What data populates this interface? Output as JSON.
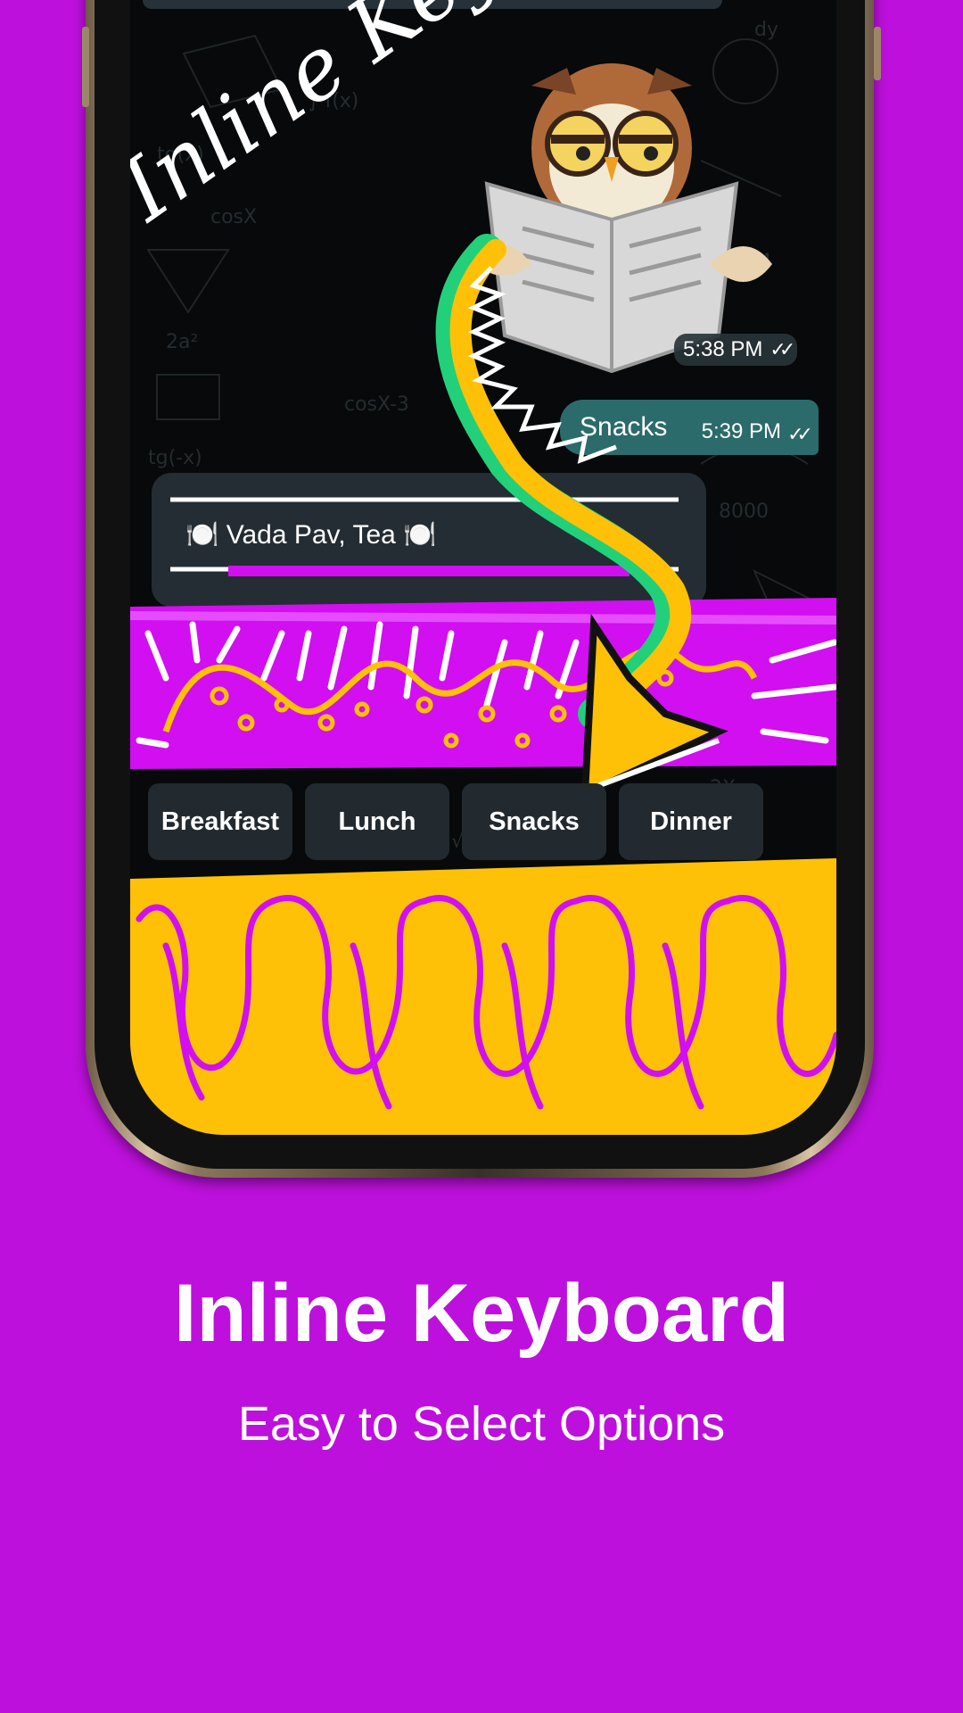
{
  "chat": {
    "sticker_time": "5:38 PM",
    "outgoing_message": {
      "text": "Snacks",
      "time": "5:39 PM"
    },
    "incoming_message": {
      "text": "🍽️ Vada Pav, Tea 🍽️"
    },
    "status_icon": "double-check-icon"
  },
  "inline_keyboard": {
    "buttons": [
      {
        "label": "Breakfast"
      },
      {
        "label": "Lunch"
      },
      {
        "label": "Snacks"
      },
      {
        "label": "Dinner"
      }
    ]
  },
  "annotation": {
    "handwritten_text": "Inline Keyboard"
  },
  "caption": {
    "title": "Inline Keyboard",
    "subtitle": "Easy to Select Options"
  },
  "colors": {
    "background": "#bd10dc",
    "outgoing_bubble": "#2b6b6b",
    "incoming_bubble": "#242d33",
    "keyboard_button": "#222a30",
    "accent_yellow": "#ffc107",
    "accent_magenta": "#d10ff0",
    "accent_green": "#22d07a"
  }
}
